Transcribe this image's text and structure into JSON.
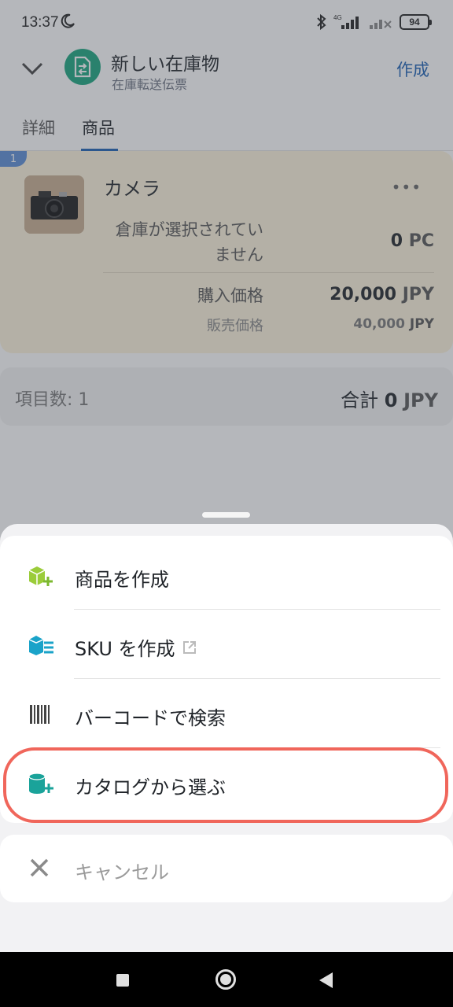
{
  "status_bar": {
    "time": "13:37",
    "battery": "94",
    "network": "4G"
  },
  "header": {
    "title": "新しい在庫物",
    "subtitle": "在庫転送伝票",
    "create_label": "作成"
  },
  "tabs": [
    {
      "label": "詳細"
    },
    {
      "label": "商品"
    }
  ],
  "item": {
    "index": "1",
    "name": "カメラ",
    "more": "•••",
    "warehouse_label": "倉庫が選択されていません",
    "warehouse_qty": "0",
    "warehouse_unit": "PC",
    "purchase_label": "購入価格",
    "purchase_value": "20,000",
    "purchase_unit": "JPY",
    "sale_label": "販売価格",
    "sale_value": "40,000",
    "sale_unit": "JPY"
  },
  "summary": {
    "count_label": "項目数: 1",
    "total_label": "合計",
    "total_value": "0",
    "total_unit": "JPY"
  },
  "sheet": {
    "items": [
      {
        "label": "商品を作成",
        "icon": "box-plus-icon"
      },
      {
        "label": "SKU を作成",
        "icon": "sku-stack-icon"
      },
      {
        "label": "バーコードで検索",
        "icon": "barcode-icon"
      },
      {
        "label": "カタログから選ぶ",
        "icon": "catalog-plus-icon"
      }
    ],
    "cancel_label": "キャンセル"
  },
  "colors": {
    "accent": "#1a5fb4",
    "green": "#18a57e",
    "lime": "#8cc63f",
    "teal": "#1aa3c9",
    "highlight": "#f0665b"
  }
}
